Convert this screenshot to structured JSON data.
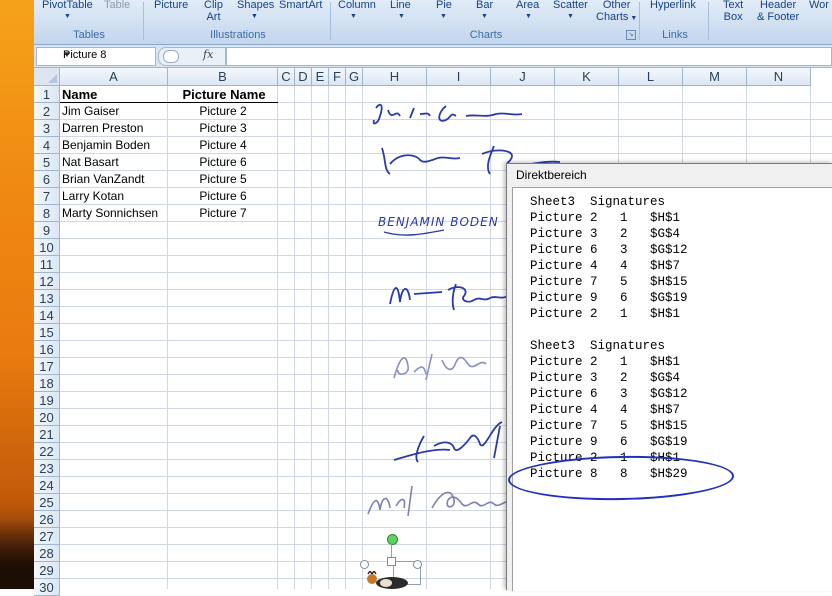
{
  "ribbon": {
    "groups": [
      {
        "name": "Tables",
        "buttons": [
          "PivotTable",
          "Table"
        ]
      },
      {
        "name": "Illustrations",
        "buttons": [
          "Picture",
          "Clip Art",
          "Shapes",
          "SmartArt"
        ]
      },
      {
        "name": "Charts",
        "buttons": [
          "Column",
          "Line",
          "Pie",
          "Bar",
          "Area",
          "Scatter",
          "Other Charts"
        ]
      },
      {
        "name": "Links",
        "buttons": [
          "Hyperlink"
        ]
      },
      {
        "name": "",
        "buttons": [
          "Text Box",
          "Header & Footer",
          "Wor"
        ]
      }
    ],
    "labels": {
      "pivot": "PivotTable",
      "table": "Table",
      "tables": "Tables",
      "picture": "Picture",
      "clip1": "Clip",
      "clip2": "Art",
      "shapes": "Shapes",
      "smartart": "SmartArt",
      "illustrations": "Illustrations",
      "column": "Column",
      "line": "Line",
      "pie": "Pie",
      "bar": "Bar",
      "area": "Area",
      "scatter": "Scatter",
      "other1": "Other",
      "other2": "Charts",
      "charts": "Charts",
      "hyperlink": "Hyperlink",
      "links": "Links",
      "text1": "Text",
      "text2": "Box",
      "header1": "Header",
      "header2": "& Footer",
      "wor": "Wor"
    }
  },
  "formula_bar": {
    "name_box": "Picture 8",
    "fx": "fx",
    "content": ""
  },
  "columns": [
    "A",
    "B",
    "C",
    "D",
    "E",
    "F",
    "G",
    "H",
    "I",
    "J",
    "K",
    "L",
    "M",
    "N"
  ],
  "rows": [
    "1",
    "2",
    "3",
    "4",
    "5",
    "6",
    "7",
    "8",
    "9",
    "10",
    "11",
    "12",
    "13",
    "14",
    "15",
    "16",
    "17",
    "18",
    "19",
    "20",
    "21",
    "22",
    "23",
    "24",
    "25",
    "26",
    "27",
    "28",
    "29",
    "30"
  ],
  "table": {
    "headers": [
      "Name",
      "Picture Name"
    ],
    "rows": [
      [
        "Jim Gaiser",
        "Picture 2"
      ],
      [
        "Darren Preston",
        "Picture 3"
      ],
      [
        "Benjamin Boden",
        "Picture 4"
      ],
      [
        "Nat Basart",
        "Picture 6"
      ],
      [
        "Brian VanZandt",
        "Picture 5"
      ],
      [
        "Larry Kotan",
        "Picture 6"
      ],
      [
        "Marty Sonnichsen",
        "Picture 7"
      ]
    ]
  },
  "immediate_window": {
    "title": "Direktbereich",
    "lines": [
      "Sheet3  Signatures",
      "Picture 2   1   $H$1",
      "Picture 3   2   $G$4",
      "Picture 6   3   $G$12",
      "Picture 4   4   $H$7",
      "Picture 7   5   $H$15",
      "Picture 9   6   $G$19",
      "Picture 2   1   $H$1",
      "",
      "Sheet3  Signatures",
      "Picture 2   1   $H$1",
      "Picture 3   2   $G$4",
      "Picture 6   3   $G$12",
      "Picture 4   4   $H$7",
      "Picture 7   5   $H$15",
      "Picture 9   6   $G$19",
      "Picture 2   1   $H$1",
      "Picture 8   8   $H$29"
    ]
  },
  "colors": {
    "ribbon_text": "#15428b",
    "annotation": "#1f2fbf",
    "signature_ink": "#2a3aa8"
  }
}
